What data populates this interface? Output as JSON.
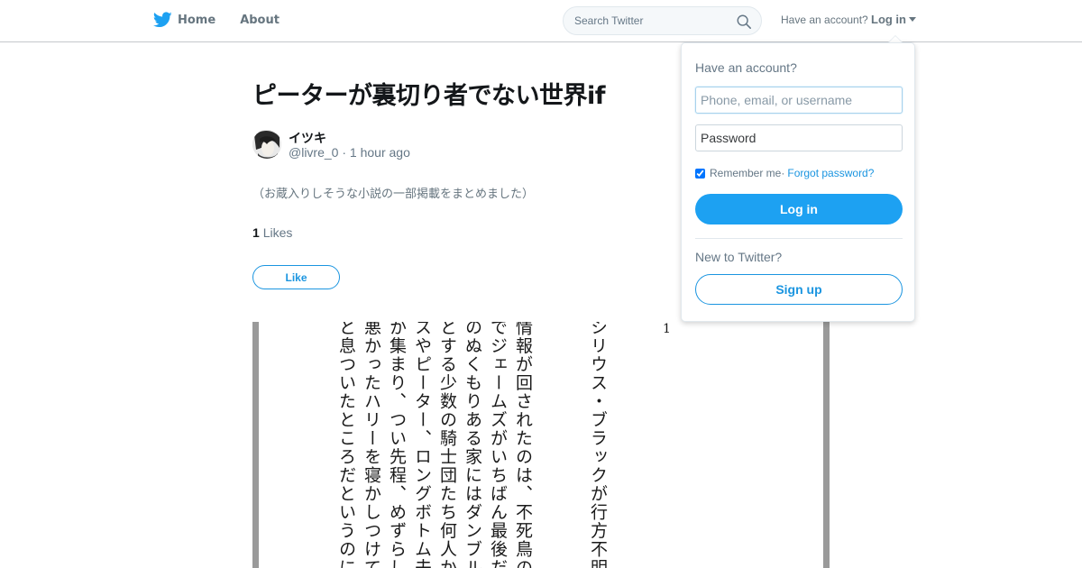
{
  "nav": {
    "home_label": "Home",
    "about_label": "About",
    "search_placeholder": "Search Twitter",
    "account_prompt": "Have an account?",
    "login_label": "Log in",
    "brand_color": "#1da1f2"
  },
  "moment": {
    "title": "ピーターが裏切り者でない世界if",
    "author_name": "イツキ",
    "author_handle": "@livre_0",
    "separator": " · ",
    "timestamp": "1 hour ago",
    "description": "（お蔵入りしそうな小説の一部掲載をまとめました）",
    "likes_count": "1",
    "likes_label": "Likes",
    "like_button_label": "Like"
  },
  "page_image": {
    "page_number": "1",
    "columns": [
      "シリウス・ブラックが行方不明に",
      "情報が回されたのは、不死鳥の騎",
      "でジェームズがいちばん最後だっ",
      "のぬくもりある家にはダンブルド",
      "とする少数の騎士団たち何人か—",
      "スやピーター、ロングボトム夫妻",
      "か集まり、つい先程、めずらしく",
      "悪かったハリーを寝かしつけてよ",
      "と息ついたところだというのに、"
    ]
  },
  "login_dropdown": {
    "heading": "Have an account?",
    "username_placeholder": "Phone, email, or username",
    "password_placeholder": "Password",
    "remember_label": "Remember me",
    "separator": " · ",
    "forgot_label": "Forgot password?",
    "login_button": "Log in",
    "new_prompt": "New to Twitter?",
    "signup_button": "Sign up"
  }
}
